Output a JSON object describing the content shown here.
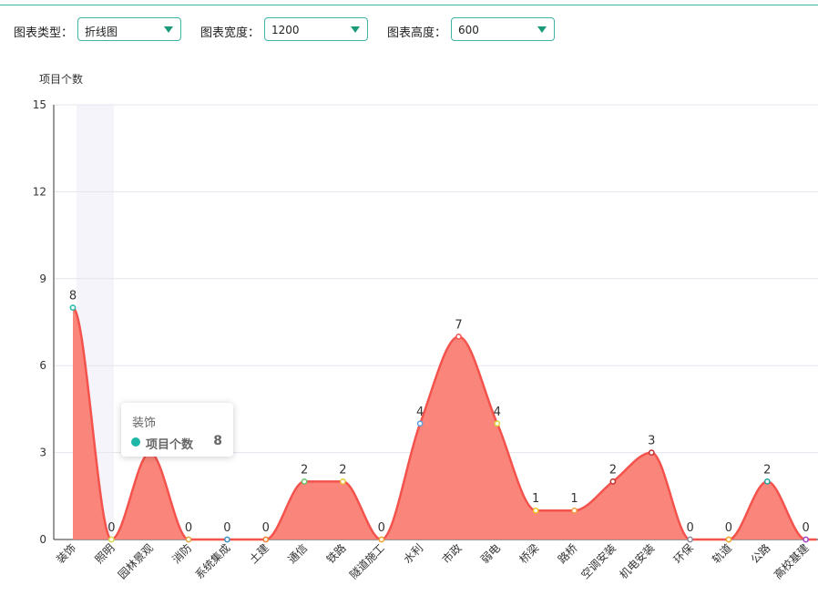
{
  "controls": {
    "chart_type_label": "图表类型：",
    "chart_type_value": "折线图",
    "width_label": "图表宽度：",
    "width_value": "1200",
    "height_label": "图表高度：",
    "height_value": "600"
  },
  "tooltip": {
    "category": "装饰",
    "series": "项目个数",
    "value": "8"
  },
  "colors": {
    "accent": "#3fb5a6",
    "caret": "#1a9a78",
    "line": "#f4524c",
    "area": "#fa8074",
    "highlight_band": "#f4f4fa"
  },
  "chart_data": {
    "type": "area",
    "title": "",
    "xlabel": "",
    "ylabel": "项目个数",
    "ylim": [
      0,
      15
    ],
    "yticks": [
      0,
      3,
      6,
      9,
      12,
      15
    ],
    "grid": true,
    "smooth": true,
    "highlighted_category": "装饰",
    "categories": [
      "装饰",
      "照明",
      "园林景观",
      "消防",
      "系统集成",
      "土建",
      "通信",
      "铁路",
      "隧道施工",
      "水利",
      "市政",
      "弱电",
      "桥梁",
      "路桥",
      "空调安装",
      "机电安装",
      "环保",
      "轨道",
      "公路",
      "高校基建"
    ],
    "series": [
      {
        "name": "项目个数",
        "values": [
          8,
          0,
          3,
          0,
          0,
          0,
          2,
          2,
          0,
          4,
          7,
          4,
          1,
          1,
          2,
          3,
          0,
          0,
          2,
          0
        ]
      }
    ],
    "data_labels": [
      "8",
      "0",
      "",
      "0",
      "0",
      "0",
      "2",
      "2",
      "0",
      "4",
      "7",
      "4",
      "1",
      "1",
      "2",
      "3",
      "0",
      "0",
      "2",
      "0"
    ],
    "point_colors": [
      "#1fb8a6",
      "#e0d94a",
      "#f4524c",
      "#e0a33a",
      "#3a8fbf",
      "#f07c2e",
      "#6ac26a",
      "#e8c23a",
      "#f0a030",
      "#5aa0e0",
      "#f4524c",
      "#d9d940",
      "#f0c020",
      "#f0a040",
      "#c03030",
      "#c03030",
      "#8a8aa0",
      "#f0a020",
      "#1fa0a0",
      "#a040c0"
    ]
  }
}
